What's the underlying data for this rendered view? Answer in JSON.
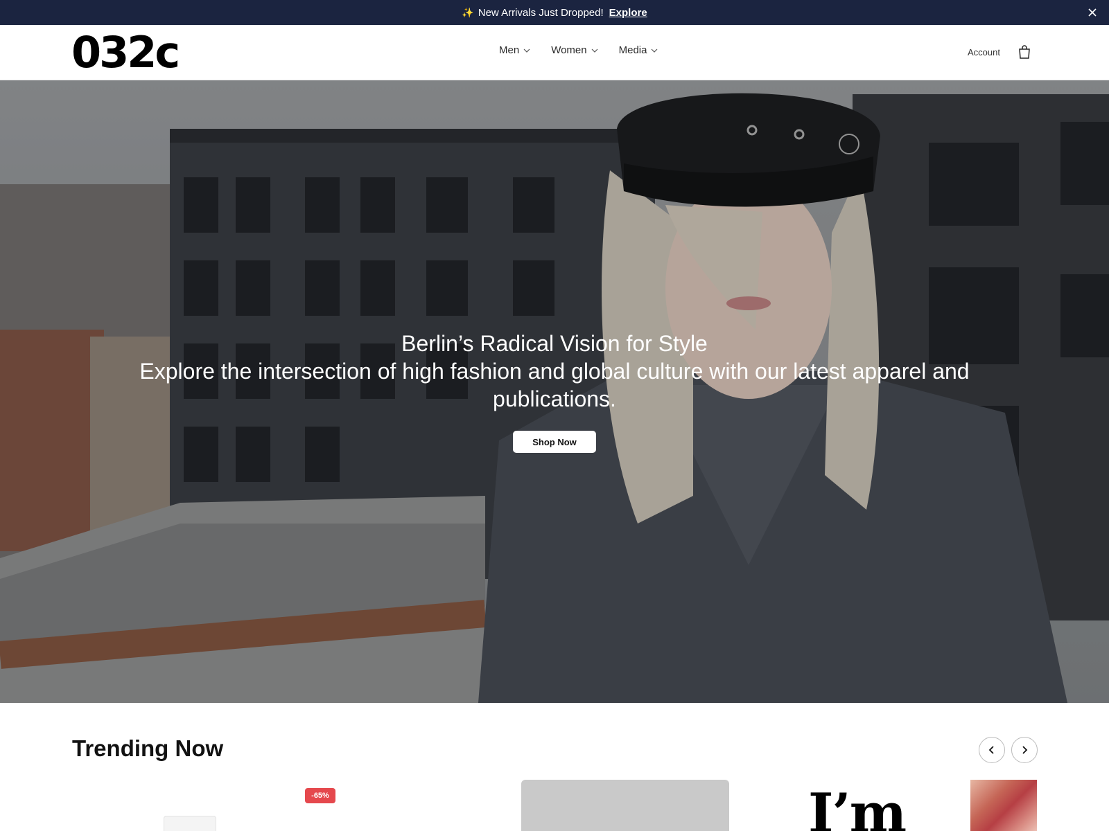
{
  "announcement": {
    "text": "New Arrivals Just Dropped!",
    "link": "Explore",
    "sparkle_icon": "sparkle-icon",
    "close_icon": "close-icon"
  },
  "header": {
    "logo": "032c",
    "nav": [
      {
        "label": "Men"
      },
      {
        "label": "Women"
      },
      {
        "label": "Media"
      }
    ],
    "account": "Account",
    "bag_icon": "shopping-bag-icon"
  },
  "hero": {
    "title": "Berlin’s Radical Vision for Style",
    "subtitle": "Explore the intersection of high fashion and global culture with our latest apparel and publications.",
    "cta": "Shop Now"
  },
  "trending": {
    "title": "Trending Now",
    "prev_icon": "chevron-left-icon",
    "next_icon": "chevron-right-icon",
    "products": [
      {
        "badge": ""
      },
      {
        "badge": "-65%"
      },
      {
        "badge": ""
      },
      {
        "badge": "",
        "image_text": "I’m"
      },
      {
        "badge": ""
      }
    ]
  },
  "colors": {
    "announcement_bg": "#1b2440",
    "sale_badge": "#e5484d",
    "text": "#111111"
  }
}
